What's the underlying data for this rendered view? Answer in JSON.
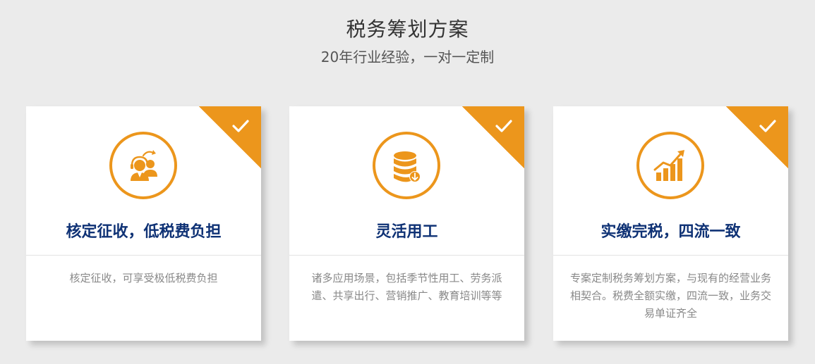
{
  "header": {
    "title": "税务筹划方案",
    "subtitle": "20年行业经验，一对一定制"
  },
  "colors": {
    "accent": "#ec961c",
    "title": "#0f3275",
    "desc": "#888888",
    "background": "#ebebeb"
  },
  "cards": [
    {
      "icon": "customer-service-icon",
      "title": "核定征收，低税费负担",
      "desc": "核定征收，可享受极低税费负担"
    },
    {
      "icon": "database-icon",
      "title": "灵活用工",
      "desc": "诸多应用场景，包括季节性用工、劳务派遣、共享出行、营销推广、教育培训等等"
    },
    {
      "icon": "growth-chart-icon",
      "title": "实缴完税，四流一致",
      "desc": "专案定制税务筹划方案，与现有的经营业务相契合。税费全额实缴，四流一致，业务交易单证齐全"
    }
  ]
}
